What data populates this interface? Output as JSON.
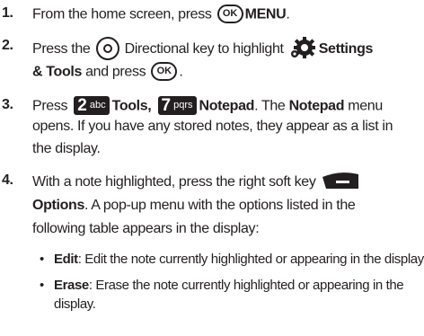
{
  "steps": [
    {
      "num": "1.",
      "lines": [
        {
          "parts": [
            "From the home screen, press ",
            "OK",
            " ",
            "MENU",
            "."
          ]
        }
      ]
    },
    {
      "num": "2.",
      "lines": [
        {
          "parts": [
            "Press the ",
            " Directional key to highlight ",
            "Settings"
          ]
        },
        {
          "parts": [
            "& Tools",
            " and press ",
            "OK",
            "."
          ]
        }
      ]
    },
    {
      "num": "3.",
      "lines": [
        {
          "parts": [
            "Press ",
            "abc",
            "Tools,",
            "pqrs",
            "Notepad",
            ". The ",
            "Notepad",
            " menu"
          ]
        },
        {
          "parts": [
            "opens. If you have any stored notes, they appear as a list in"
          ]
        },
        {
          "parts": [
            "the display."
          ]
        }
      ]
    },
    {
      "num": "4.",
      "lines": [
        {
          "parts": [
            "With a note highlighted, press the right soft key"
          ]
        },
        {
          "parts": [
            "Options",
            ". A pop-up menu with the options listed in the"
          ]
        },
        {
          "parts": [
            "following table appears in the display:"
          ]
        }
      ]
    }
  ],
  "keys": {
    "two_digit": "2",
    "two_letters": "abc",
    "seven_digit": "7",
    "seven_letters": "pqrs",
    "ok_label": "OK"
  },
  "bullets": [
    {
      "term": "Edit",
      "lines": [
        ": Edit the note currently highlighted or appearing in the display."
      ]
    },
    {
      "term": "Erase",
      "lines": [
        ": Erase the note currently highlighted or appearing in the",
        "display."
      ]
    }
  ],
  "bullet_symbol": "•",
  "icons": [
    "ok-key-icon",
    "directional-key-icon",
    "settings-gear-icon",
    "key-2abc-icon",
    "key-7pqrs-icon",
    "right-soft-key-icon"
  ]
}
